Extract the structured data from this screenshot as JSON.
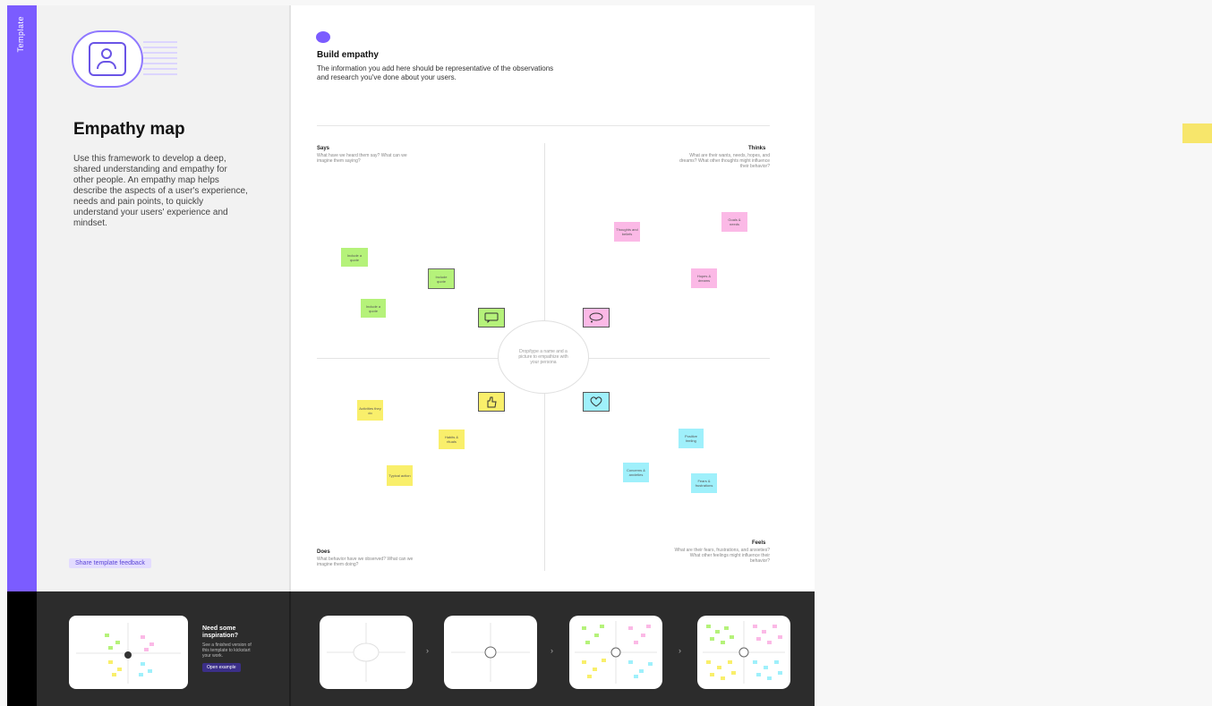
{
  "sidebar": {
    "vertical_label": "Template"
  },
  "intro": {
    "title": "Empathy map",
    "description": "Use this framework to develop a deep, shared understanding and empathy for other people. An empathy map helps describe the aspects of a user's experience, needs and pain points, to quickly understand your users' experience and mindset.",
    "feedback_label": "Share template feedback"
  },
  "section": {
    "title": "Build empathy",
    "description": "The information you add here should be representative of the observations and research you've done about your users."
  },
  "center": {
    "text": "Drop/type a name and a picture to empathize with your persona"
  },
  "quadrants": {
    "says": {
      "label": "Says",
      "hint": "What have we heard them say? What can we imagine them saying?"
    },
    "thinks": {
      "label": "Thinks",
      "hint": "What are their wants, needs, hopes, and dreams? What other thoughts might influence their behavior?"
    },
    "does": {
      "label": "Does",
      "hint": "What behavior have we observed? What can we imagine them doing?"
    },
    "feels": {
      "label": "Feels",
      "hint": "What are their fears, frustrations, and anxieties? What other feelings might influence their behavior?"
    }
  },
  "notes": {
    "green": [
      "Include a quote",
      "Include quote",
      "Include a quote"
    ],
    "pink": [
      "Thoughts and beliefs",
      "Goals & needs",
      "Hopes & dreams"
    ],
    "yellow": [
      "Activities they do",
      "Habits & rituals",
      "Typical action"
    ],
    "blue": [
      "Positive feeling",
      "Concerns & anxieties",
      "Fears & frustrations"
    ]
  },
  "inspiration": {
    "title": "Need some inspiration?",
    "description": "See a finished version of this template to kickstart your work.",
    "button_label": "Open example"
  },
  "icons": {
    "persona": "persona-icon",
    "say": "speech-bubble-icon",
    "think": "thought-bubble-icon",
    "do": "thumbs-up-icon",
    "feel": "heart-icon"
  },
  "colors": {
    "accent": "#7b5cff",
    "green_note": "#b5f27a",
    "pink_note": "#fbb9e6",
    "yellow_note": "#f9ef6b",
    "blue_note": "#9ff0fb"
  }
}
